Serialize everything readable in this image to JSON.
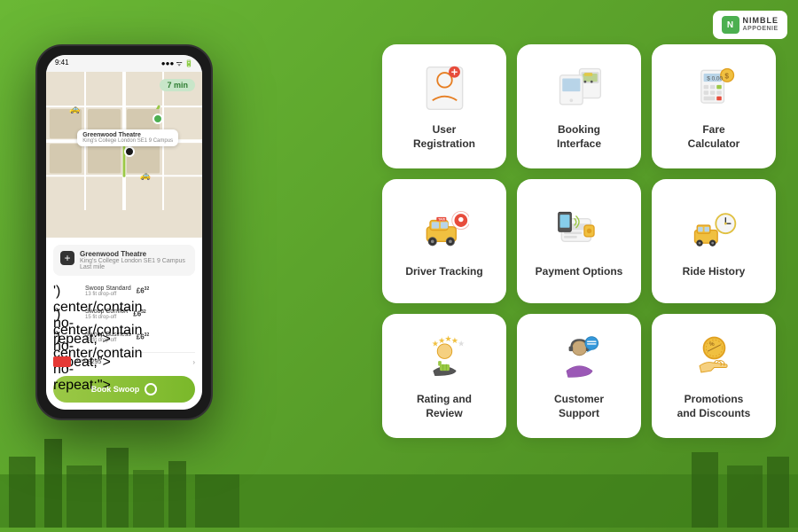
{
  "app": {
    "logo": {
      "brand": "NIMBLE",
      "sub": "APPOENIE"
    }
  },
  "phone": {
    "status_time": "9:41",
    "map_time_badge": "7 min",
    "location_name": "Greenwood Theatre",
    "location_addr": "King's College London SE1 9 Campus",
    "location_addr2": "Last mile",
    "ride_options": [
      {
        "name": "Swoop Standard",
        "sub": "13 fit drop-off",
        "price": "£6",
        "cents": "32"
      },
      {
        "name": "Swoop Comfort",
        "sub": "15 fit drop-off",
        "price": "£6",
        "cents": "32"
      },
      {
        "name": "Swoop Business",
        "sub": "13 fit drop-off",
        "price": "£6",
        "cents": "32"
      }
    ],
    "card_number": "**** 8295",
    "book_button": "Book Swoop",
    "add_stop": "+"
  },
  "features": [
    {
      "id": "user-registration",
      "label": "User\nRegistration",
      "icon": "user-reg"
    },
    {
      "id": "booking-interface",
      "label": "Booking\nInterface",
      "icon": "booking"
    },
    {
      "id": "fare-calculator",
      "label": "Fare\nCalculator",
      "icon": "fare"
    },
    {
      "id": "driver-tracking",
      "label": "Driver Tracking",
      "icon": "tracking"
    },
    {
      "id": "payment-options",
      "label": "Payment Options",
      "icon": "payment"
    },
    {
      "id": "ride-history",
      "label": "Ride History",
      "icon": "history"
    },
    {
      "id": "rating-review",
      "label": "Rating and\nReview",
      "icon": "rating"
    },
    {
      "id": "customer-support",
      "label": "Customer\nSupport",
      "icon": "support"
    },
    {
      "id": "promotions",
      "label": "Promotions\nand Discounts",
      "icon": "promo"
    }
  ]
}
